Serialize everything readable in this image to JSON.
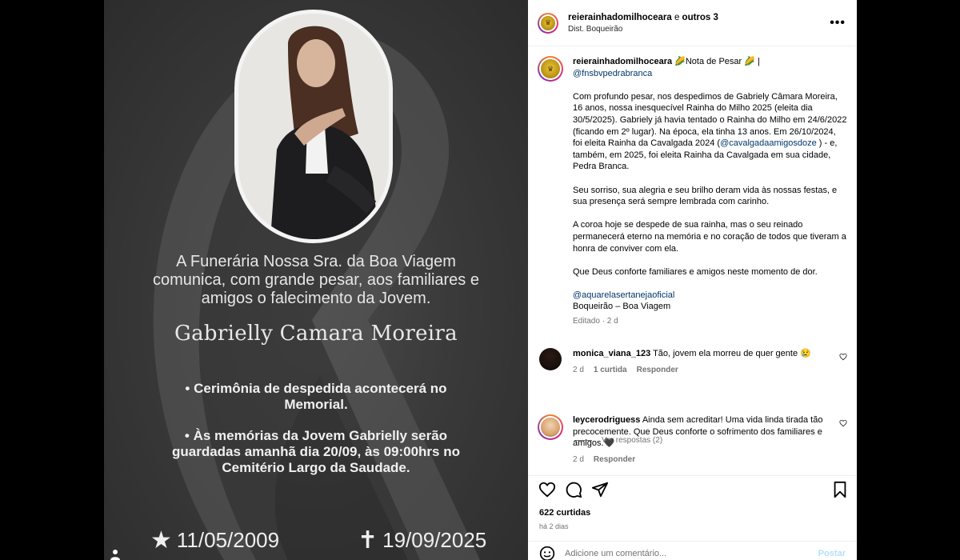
{
  "post_image": {
    "announcement": "A Funerária Nossa Sra. da Boa Viagem comunica, com grande pesar, aos familiares e amigos o falecimento da Jovem.",
    "name": "Gabrielly Camara Moreira",
    "bullet_1": "• Cerimônia de despedida acontecerá no Memorial.",
    "bullet_2": "• Às memórias da Jovem Gabrielly serão guardadas amanhã dia 20/09, às 09:00hrs no Cemitério Largo da Saudade.",
    "birth_glyph": "★",
    "birth_date": "11/05/2009",
    "death_glyph": "✝",
    "death_date": "19/09/2025"
  },
  "header": {
    "username": "reierainhadomilhoceara",
    "collab_text": " e ",
    "others": "outros 3",
    "location": "Dist. Boqueirão",
    "more_label": "•••"
  },
  "caption": {
    "username": "reierainhadomilhoceara",
    "title": " 🌽Nota de Pesar 🌽 |",
    "mention_top": "@fnsbvpedrabranca",
    "p1_a": "Com profundo pesar, nos despedimos de Gabriely Câmara Moreira, 16 anos, nossa inesquecível Rainha do Milho 2025 (eleita dia 30/5/2025). Gabriely já havia tentado o Rainha do Milho em 24/6/2022 (ficando em 2º lugar). Na época, ela tinha 13 anos. Em 26/10/2024, foi eleita Rainha da Cavalgada 2024 (",
    "p1_mention": "@cavalgadaamigosdoze",
    "p1_b": " ) - e, também, em 2025, foi eleita Rainha da Cavalgada em sua cidade, Pedra Branca.",
    "p2": "Seu sorriso, sua alegria e seu brilho deram vida às nossas festas, e sua presença será sempre lembrada com carinho.",
    "p3": "A coroa hoje se despede de sua rainha, mas o seu reinado permanecerá eterno na memória e no coração de todos que tiveram a honra de conviver com ela.",
    "p4": "Que Deus conforte familiares e amigos neste momento de dor.",
    "mention_bottom": "@aquarelasertanejaoficial",
    "location_line": "Boqueirão – Boa Viagem",
    "meta": "Editado · 2 d"
  },
  "comments": [
    {
      "username": "monica_viana_123",
      "text": " Tão, jovem ela morreu de quer gente 😢",
      "age": "2 d",
      "likes": "1 curtida",
      "reply": "Responder"
    },
    {
      "username": "leycerodriguess",
      "text": " Ainda sem acreditar! Uma vida linda tirada tão precocemente. Que Deus conforte o sofrimento dos familiares e amigos.🖤",
      "age": "2 d",
      "reply": "Responder"
    }
  ],
  "view_replies": "Ver respostas (2)",
  "actions": {
    "likes": "622 curtidas",
    "age": "há 2 dias"
  },
  "add_comment": {
    "placeholder": "Adicione um comentário...",
    "post_label": "Postar"
  },
  "colors": {
    "link": "#00376b",
    "muted": "#737373",
    "post_button": "#b2dffc"
  }
}
